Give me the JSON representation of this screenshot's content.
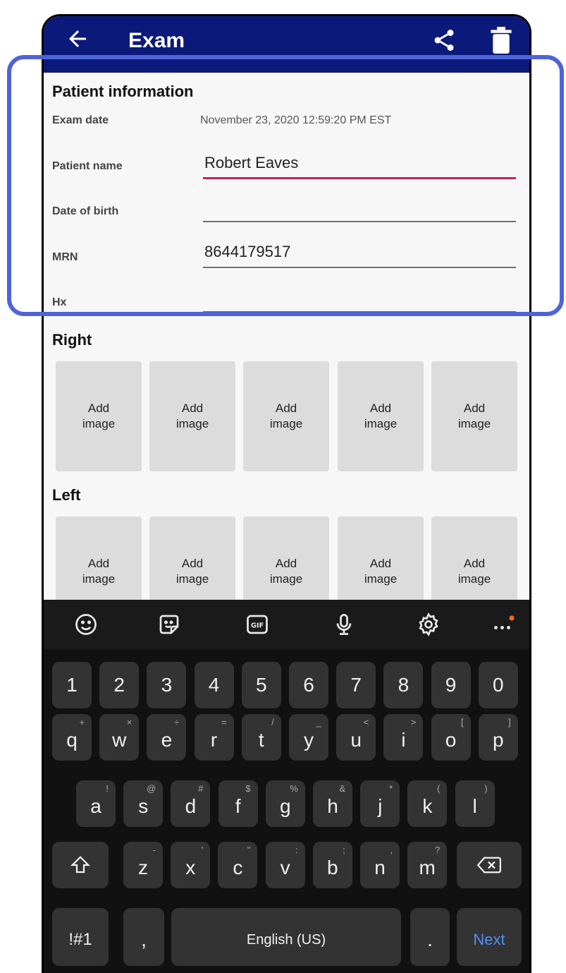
{
  "appbar": {
    "title": "Exam",
    "icons": [
      "arrow-left-icon",
      "share-icon",
      "trash-icon"
    ]
  },
  "patient_info": {
    "heading": "Patient information",
    "exam_date_label": "Exam date",
    "exam_date_value": "November 23, 2020 12:59:20 PM EST",
    "patient_name_label": "Patient name",
    "patient_name_value": "Robert Eaves",
    "dob_label": "Date of birth",
    "dob_value": "",
    "mrn_label": "MRN",
    "mrn_value": "8644179517",
    "hx_label": "Hx",
    "hx_value": ""
  },
  "right": {
    "heading": "Right",
    "tiles": [
      "Add\nimage",
      "Add\nimage",
      "Add\nimage",
      "Add\nimage",
      "Add\nimage"
    ]
  },
  "left": {
    "heading": "Left",
    "tiles": [
      "Add\nimage",
      "Add\nimage",
      "Add\nimage",
      "Add\nimage",
      "Add\nimage"
    ]
  },
  "keyboard": {
    "row_digits": [
      "1",
      "2",
      "3",
      "4",
      "5",
      "6",
      "7",
      "8",
      "9",
      "0"
    ],
    "row_q": [
      {
        "k": "q",
        "s": "+"
      },
      {
        "k": "w",
        "s": "×"
      },
      {
        "k": "e",
        "s": "÷"
      },
      {
        "k": "r",
        "s": "="
      },
      {
        "k": "t",
        "s": "/"
      },
      {
        "k": "y",
        "s": "_"
      },
      {
        "k": "u",
        "s": "<"
      },
      {
        "k": "i",
        "s": ">"
      },
      {
        "k": "o",
        "s": "["
      },
      {
        "k": "p",
        "s": "]"
      }
    ],
    "row_a": [
      {
        "k": "a",
        "s": "!"
      },
      {
        "k": "s",
        "s": "@"
      },
      {
        "k": "d",
        "s": "#"
      },
      {
        "k": "f",
        "s": "$"
      },
      {
        "k": "g",
        "s": "%"
      },
      {
        "k": "h",
        "s": "&"
      },
      {
        "k": "j",
        "s": "*"
      },
      {
        "k": "k",
        "s": "("
      },
      {
        "k": "l",
        "s": ")"
      }
    ],
    "row_z": [
      {
        "k": "z",
        "s": "-"
      },
      {
        "k": "x",
        "s": "'"
      },
      {
        "k": "c",
        "s": "\""
      },
      {
        "k": "v",
        "s": ":"
      },
      {
        "k": "b",
        "s": ";"
      },
      {
        "k": "n",
        "s": ","
      },
      {
        "k": "m",
        "s": "?"
      }
    ],
    "symbols_label": "!#1",
    "comma": ",",
    "space_label": "English (US)",
    "period": ".",
    "next_label": "Next",
    "accent_dot_color": "#f26b1d"
  },
  "colors": {
    "appbar": "#0b1a7a",
    "focus_underline": "#c2255c",
    "highlight_border": "#4f63d9",
    "next_key": "#4f8ff7"
  }
}
